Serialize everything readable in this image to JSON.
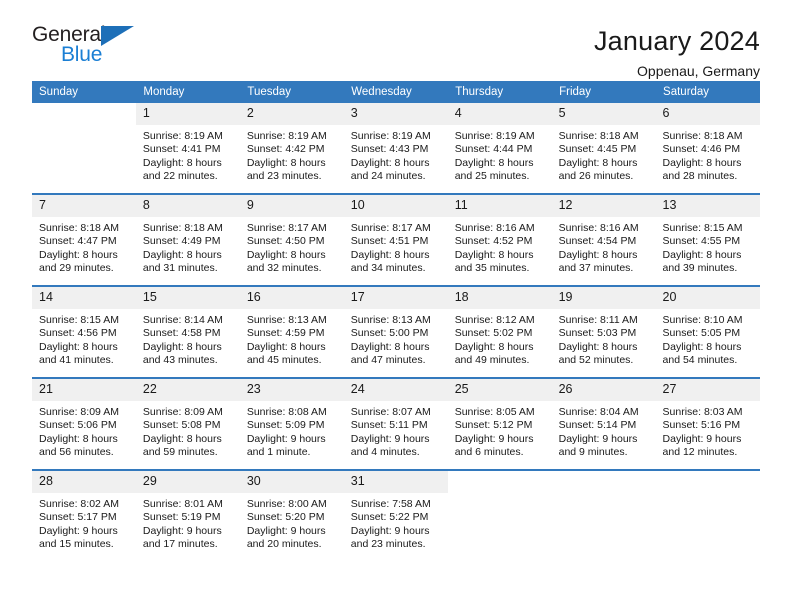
{
  "brand": {
    "name_dark": "General",
    "name_light": "Blue",
    "accent_color": "#1b7fd4",
    "triangle_color": "#1d6fb8"
  },
  "header": {
    "title": "January 2024",
    "location": "Oppenau, Germany"
  },
  "calendar": {
    "header_background": "#3379bd",
    "daynum_background": "#f0f0f0",
    "weekday_headers": [
      "Sunday",
      "Monday",
      "Tuesday",
      "Wednesday",
      "Thursday",
      "Friday",
      "Saturday"
    ],
    "weeks": [
      [
        {
          "day": "",
          "lines": []
        },
        {
          "day": "1",
          "lines": [
            "Sunrise: 8:19 AM",
            "Sunset: 4:41 PM",
            "Daylight: 8 hours",
            "and 22 minutes."
          ]
        },
        {
          "day": "2",
          "lines": [
            "Sunrise: 8:19 AM",
            "Sunset: 4:42 PM",
            "Daylight: 8 hours",
            "and 23 minutes."
          ]
        },
        {
          "day": "3",
          "lines": [
            "Sunrise: 8:19 AM",
            "Sunset: 4:43 PM",
            "Daylight: 8 hours",
            "and 24 minutes."
          ]
        },
        {
          "day": "4",
          "lines": [
            "Sunrise: 8:19 AM",
            "Sunset: 4:44 PM",
            "Daylight: 8 hours",
            "and 25 minutes."
          ]
        },
        {
          "day": "5",
          "lines": [
            "Sunrise: 8:18 AM",
            "Sunset: 4:45 PM",
            "Daylight: 8 hours",
            "and 26 minutes."
          ]
        },
        {
          "day": "6",
          "lines": [
            "Sunrise: 8:18 AM",
            "Sunset: 4:46 PM",
            "Daylight: 8 hours",
            "and 28 minutes."
          ]
        }
      ],
      [
        {
          "day": "7",
          "lines": [
            "Sunrise: 8:18 AM",
            "Sunset: 4:47 PM",
            "Daylight: 8 hours",
            "and 29 minutes."
          ]
        },
        {
          "day": "8",
          "lines": [
            "Sunrise: 8:18 AM",
            "Sunset: 4:49 PM",
            "Daylight: 8 hours",
            "and 31 minutes."
          ]
        },
        {
          "day": "9",
          "lines": [
            "Sunrise: 8:17 AM",
            "Sunset: 4:50 PM",
            "Daylight: 8 hours",
            "and 32 minutes."
          ]
        },
        {
          "day": "10",
          "lines": [
            "Sunrise: 8:17 AM",
            "Sunset: 4:51 PM",
            "Daylight: 8 hours",
            "and 34 minutes."
          ]
        },
        {
          "day": "11",
          "lines": [
            "Sunrise: 8:16 AM",
            "Sunset: 4:52 PM",
            "Daylight: 8 hours",
            "and 35 minutes."
          ]
        },
        {
          "day": "12",
          "lines": [
            "Sunrise: 8:16 AM",
            "Sunset: 4:54 PM",
            "Daylight: 8 hours",
            "and 37 minutes."
          ]
        },
        {
          "day": "13",
          "lines": [
            "Sunrise: 8:15 AM",
            "Sunset: 4:55 PM",
            "Daylight: 8 hours",
            "and 39 minutes."
          ]
        }
      ],
      [
        {
          "day": "14",
          "lines": [
            "Sunrise: 8:15 AM",
            "Sunset: 4:56 PM",
            "Daylight: 8 hours",
            "and 41 minutes."
          ]
        },
        {
          "day": "15",
          "lines": [
            "Sunrise: 8:14 AM",
            "Sunset: 4:58 PM",
            "Daylight: 8 hours",
            "and 43 minutes."
          ]
        },
        {
          "day": "16",
          "lines": [
            "Sunrise: 8:13 AM",
            "Sunset: 4:59 PM",
            "Daylight: 8 hours",
            "and 45 minutes."
          ]
        },
        {
          "day": "17",
          "lines": [
            "Sunrise: 8:13 AM",
            "Sunset: 5:00 PM",
            "Daylight: 8 hours",
            "and 47 minutes."
          ]
        },
        {
          "day": "18",
          "lines": [
            "Sunrise: 8:12 AM",
            "Sunset: 5:02 PM",
            "Daylight: 8 hours",
            "and 49 minutes."
          ]
        },
        {
          "day": "19",
          "lines": [
            "Sunrise: 8:11 AM",
            "Sunset: 5:03 PM",
            "Daylight: 8 hours",
            "and 52 minutes."
          ]
        },
        {
          "day": "20",
          "lines": [
            "Sunrise: 8:10 AM",
            "Sunset: 5:05 PM",
            "Daylight: 8 hours",
            "and 54 minutes."
          ]
        }
      ],
      [
        {
          "day": "21",
          "lines": [
            "Sunrise: 8:09 AM",
            "Sunset: 5:06 PM",
            "Daylight: 8 hours",
            "and 56 minutes."
          ]
        },
        {
          "day": "22",
          "lines": [
            "Sunrise: 8:09 AM",
            "Sunset: 5:08 PM",
            "Daylight: 8 hours",
            "and 59 minutes."
          ]
        },
        {
          "day": "23",
          "lines": [
            "Sunrise: 8:08 AM",
            "Sunset: 5:09 PM",
            "Daylight: 9 hours",
            "and 1 minute."
          ]
        },
        {
          "day": "24",
          "lines": [
            "Sunrise: 8:07 AM",
            "Sunset: 5:11 PM",
            "Daylight: 9 hours",
            "and 4 minutes."
          ]
        },
        {
          "day": "25",
          "lines": [
            "Sunrise: 8:05 AM",
            "Sunset: 5:12 PM",
            "Daylight: 9 hours",
            "and 6 minutes."
          ]
        },
        {
          "day": "26",
          "lines": [
            "Sunrise: 8:04 AM",
            "Sunset: 5:14 PM",
            "Daylight: 9 hours",
            "and 9 minutes."
          ]
        },
        {
          "day": "27",
          "lines": [
            "Sunrise: 8:03 AM",
            "Sunset: 5:16 PM",
            "Daylight: 9 hours",
            "and 12 minutes."
          ]
        }
      ],
      [
        {
          "day": "28",
          "lines": [
            "Sunrise: 8:02 AM",
            "Sunset: 5:17 PM",
            "Daylight: 9 hours",
            "and 15 minutes."
          ]
        },
        {
          "day": "29",
          "lines": [
            "Sunrise: 8:01 AM",
            "Sunset: 5:19 PM",
            "Daylight: 9 hours",
            "and 17 minutes."
          ]
        },
        {
          "day": "30",
          "lines": [
            "Sunrise: 8:00 AM",
            "Sunset: 5:20 PM",
            "Daylight: 9 hours",
            "and 20 minutes."
          ]
        },
        {
          "day": "31",
          "lines": [
            "Sunrise: 7:58 AM",
            "Sunset: 5:22 PM",
            "Daylight: 9 hours",
            "and 23 minutes."
          ]
        },
        {
          "day": "",
          "lines": []
        },
        {
          "day": "",
          "lines": []
        },
        {
          "day": "",
          "lines": []
        }
      ]
    ]
  }
}
